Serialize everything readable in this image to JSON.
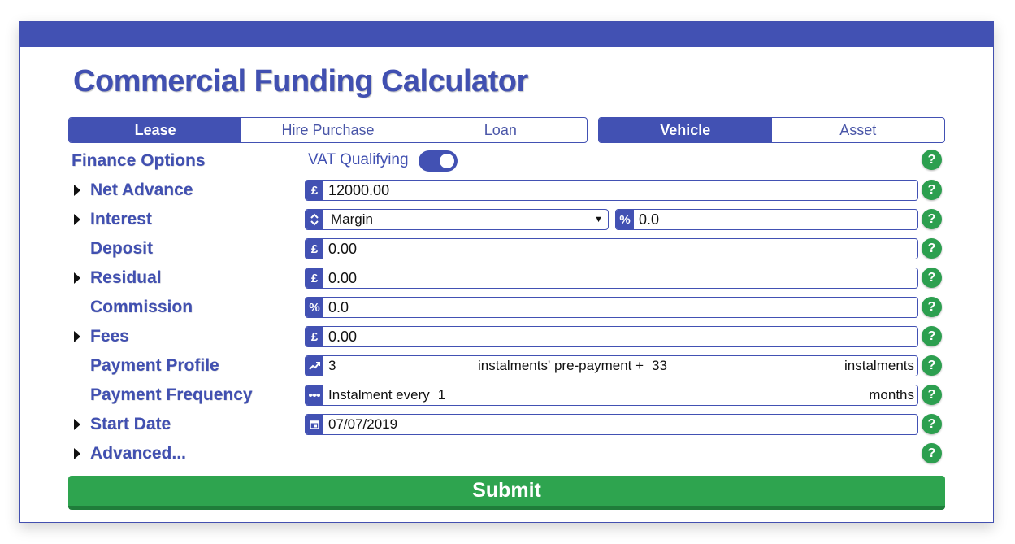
{
  "title": "Commercial Funding Calculator",
  "finance_types": [
    "Lease",
    "Hire Purchase",
    "Loan"
  ],
  "finance_type_selected": "Lease",
  "asset_types": [
    "Vehicle",
    "Asset"
  ],
  "asset_type_selected": "Vehicle",
  "finance_options": {
    "label": "Finance Options",
    "vat_label": "VAT Qualifying",
    "vat_on": true
  },
  "fields": {
    "net_advance": {
      "label": "Net Advance",
      "symbol": "£",
      "value": "12000.00"
    },
    "interest": {
      "label": "Interest",
      "select_value": "Margin",
      "symbol": "%",
      "value": "0.0"
    },
    "deposit": {
      "label": "Deposit",
      "symbol": "£",
      "value": "0.00"
    },
    "residual": {
      "label": "Residual",
      "symbol": "£",
      "value": "0.00"
    },
    "commission": {
      "label": "Commission",
      "symbol": "%",
      "value": "0.0"
    },
    "fees": {
      "label": "Fees",
      "symbol": "£",
      "value": "0.00"
    },
    "payment_profile": {
      "label": "Payment Profile",
      "pre_count": "3",
      "middle_text": "instalments' pre-payment +",
      "count": "33",
      "suffix": "instalments"
    },
    "payment_frequency": {
      "label": "Payment Frequency",
      "prefix": "Instalment every",
      "value": "1",
      "suffix": "months"
    },
    "start_date": {
      "label": "Start Date",
      "value": "07/07/2019"
    }
  },
  "advanced_label": "Advanced...",
  "help_symbol": "?",
  "submit_label": "Submit",
  "colors": {
    "primary": "#4251b3",
    "success": "#2ea44f"
  }
}
